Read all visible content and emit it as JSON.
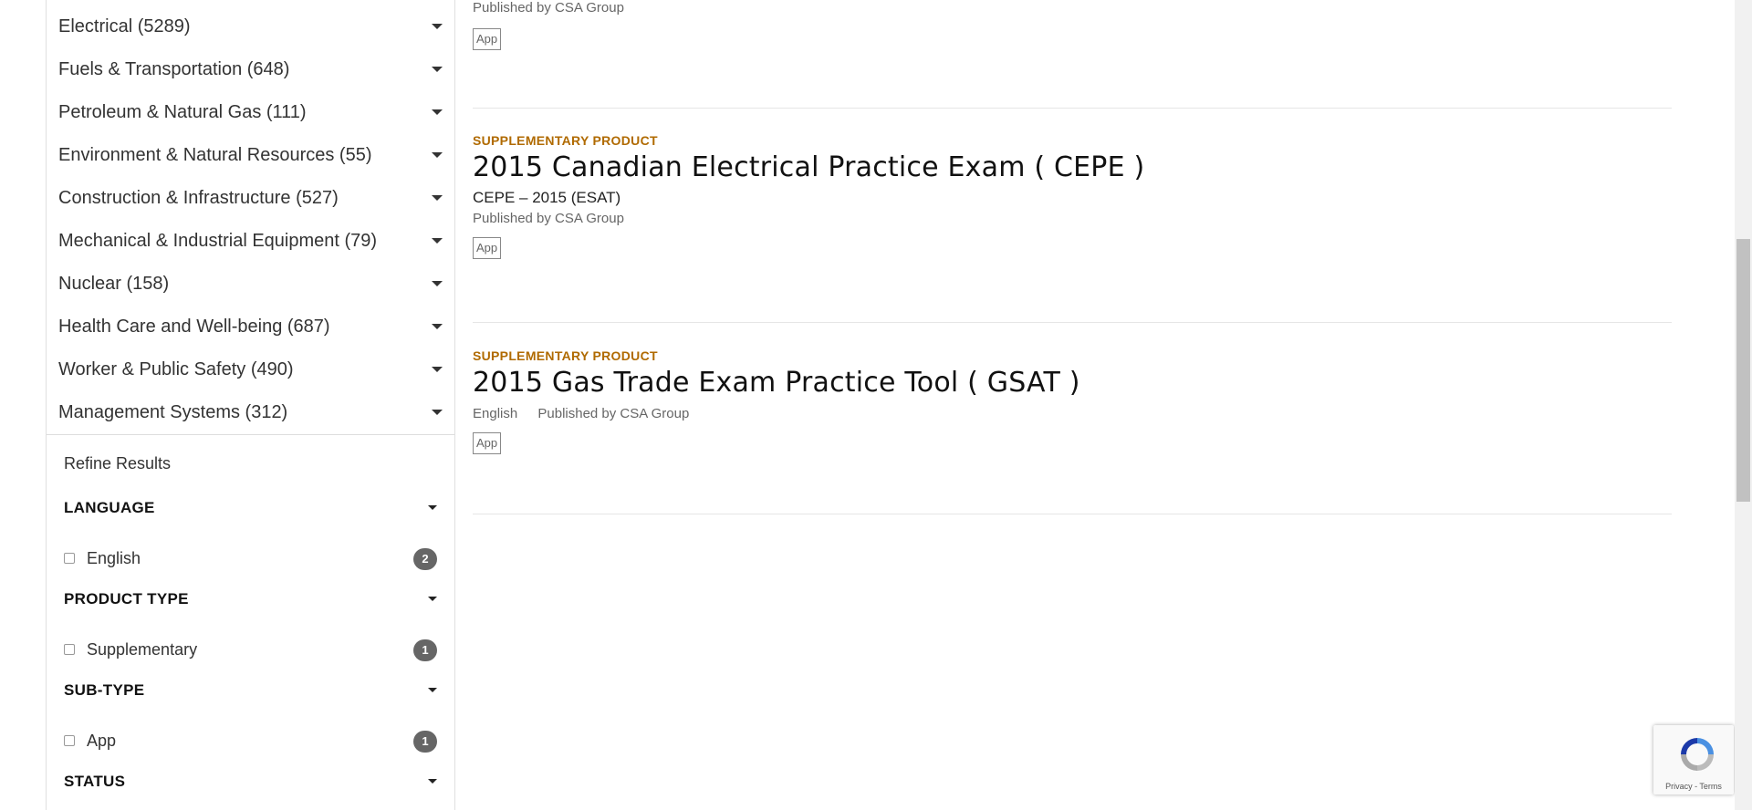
{
  "sidebar": {
    "categories": [
      {
        "label": "Electrical (5289)"
      },
      {
        "label": "Fuels & Transportation (648)"
      },
      {
        "label": "Petroleum & Natural Gas (111)"
      },
      {
        "label": "Environment & Natural Resources (55)"
      },
      {
        "label": "Construction & Infrastructure (527)"
      },
      {
        "label": "Mechanical & Industrial Equipment (79)"
      },
      {
        "label": "Nuclear (158)"
      },
      {
        "label": "Health Care and Well-being (687)"
      },
      {
        "label": "Worker & Public Safety (490)"
      },
      {
        "label": "Management Systems (312)"
      }
    ],
    "refine_title": "Refine Results",
    "facets": {
      "language": {
        "heading": "LANGUAGE",
        "option": "English",
        "count": "2"
      },
      "product_type": {
        "heading": "PRODUCT TYPE",
        "option": "Supplementary",
        "count": "1"
      },
      "sub_type": {
        "heading": "SUB-TYPE",
        "option": "App",
        "count": "1"
      },
      "status": {
        "heading": "STATUS"
      }
    }
  },
  "results": {
    "partial_top": {
      "publisher": "Published by CSA Group",
      "badge": "App"
    },
    "cepe": {
      "tag": "SUPPLEMENTARY PRODUCT",
      "title": "2015 Canadian Electrical Practice Exam ( CEPE )",
      "subtitle": "CEPE – 2015 (ESAT)",
      "publisher": "Published by CSA Group",
      "badge": "App"
    },
    "gsat": {
      "tag": "SUPPLEMENTARY PRODUCT",
      "title": "2015 Gas Trade Exam Practice Tool ( GSAT )",
      "language": "English",
      "publisher": "Published by CSA Group",
      "badge": "App"
    }
  },
  "recaptcha": {
    "links": "Privacy - Terms"
  },
  "colors": {
    "accent": "#b06a00",
    "count_badge": "#666666"
  }
}
